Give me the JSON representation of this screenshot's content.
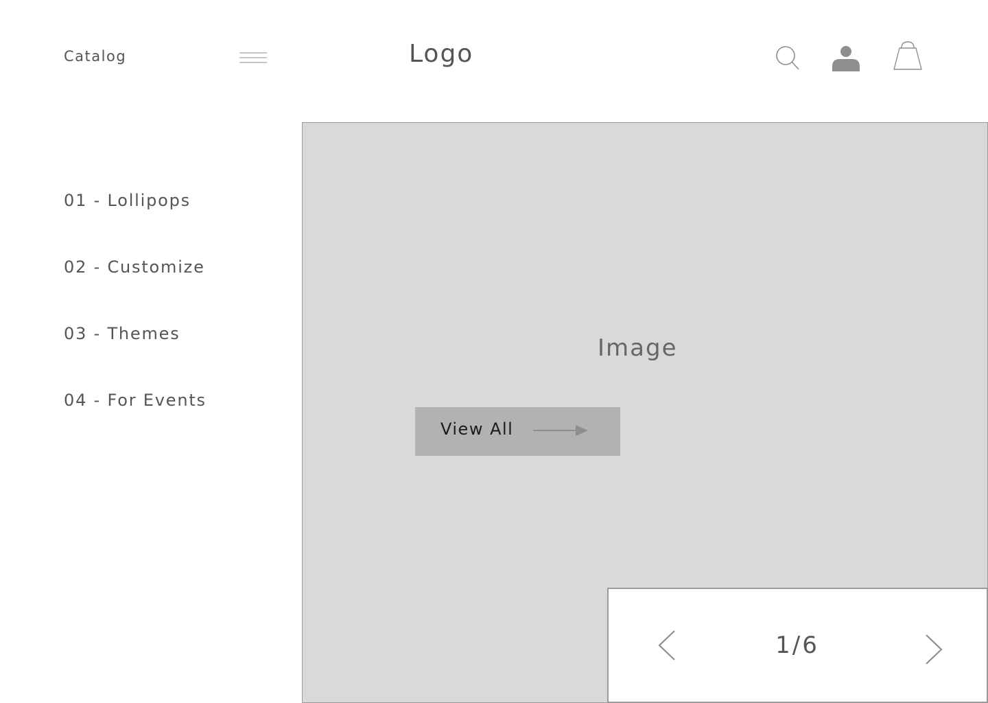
{
  "header": {
    "catalog_label": "Catalog",
    "menu_icon": "hamburger-icon",
    "logo_text": "Logo",
    "icons": [
      "search-icon",
      "user-icon",
      "shopping-bag-icon"
    ]
  },
  "side_nav": {
    "items": [
      {
        "label": "01 - Lollipops"
      },
      {
        "label": "02 - Customize"
      },
      {
        "label": "03 - Themes"
      },
      {
        "label": "04 - For Events"
      }
    ]
  },
  "hero": {
    "image_label": "Image",
    "cta_label": "View All",
    "cta_icon": "arrow-right-icon"
  },
  "pager": {
    "count": "1/6",
    "prev_icon": "chevron-left-icon",
    "next_icon": "chevron-right-icon"
  },
  "colors": {
    "text": "#555555",
    "placeholder_fill": "#d9d9d9",
    "button_fill": "#b2b2b2",
    "border": "#9a9a9a",
    "icon": "#8e8e8e"
  }
}
